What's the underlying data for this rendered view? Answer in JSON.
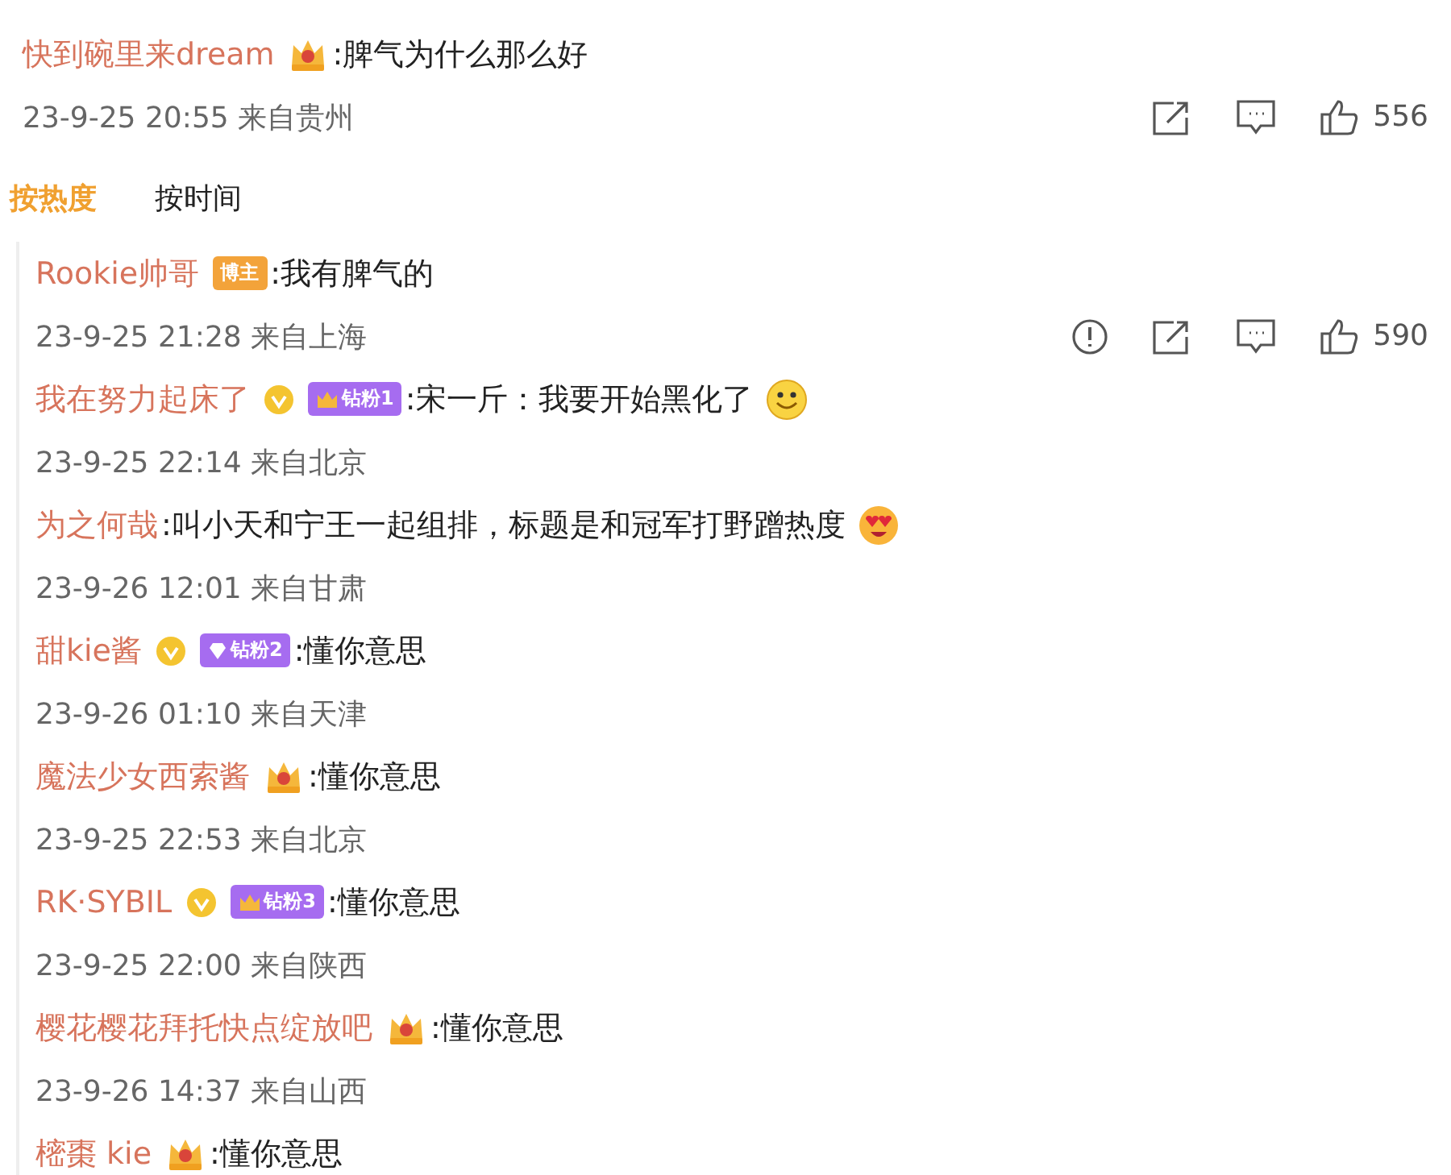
{
  "comment": {
    "name": "快到碗里来dream",
    "badges": [
      {
        "kind": "crown"
      }
    ],
    "text": ":脾气为什么那么好",
    "meta": "23-9-25 20:55 来自贵州",
    "actions": [
      {
        "kind": "share"
      },
      {
        "kind": "comment"
      },
      {
        "kind": "like"
      }
    ],
    "likes": "556"
  },
  "sort_tabs": [
    {
      "label": "按热度",
      "selected": true
    },
    {
      "label": "按时间",
      "selected": false
    }
  ],
  "replies": [
    {
      "name": "Rookie帅哥",
      "badges": [
        {
          "kind": "tag",
          "label": "博主"
        }
      ],
      "text": ":我有脾气的",
      "meta": "23-9-25 21:28 来自上海",
      "actions": [
        {
          "kind": "report"
        },
        {
          "kind": "share"
        },
        {
          "kind": "comment"
        },
        {
          "kind": "like"
        }
      ],
      "likes": "590"
    },
    {
      "name": "我在努力起床了",
      "badges": [
        {
          "kind": "verified"
        },
        {
          "kind": "fan-crown",
          "label": "钻粉1"
        }
      ],
      "text": ":宋一斤：我要开始黑化了",
      "emoji": {
        "kind": "smile"
      },
      "meta": "23-9-25 22:14 来自北京"
    },
    {
      "name": "为之何哉",
      "text": ":叫小天和宁王一起组排，标题是和冠军打野蹭热度",
      "emoji": {
        "kind": "heart-eyes"
      },
      "meta": "23-9-26 12:01 来自甘肃"
    },
    {
      "name": "甜kie酱",
      "badges": [
        {
          "kind": "verified"
        },
        {
          "kind": "fan-diamond",
          "label": "钻粉2"
        }
      ],
      "text": ":懂你意思",
      "meta": "23-9-26 01:10 来自天津"
    },
    {
      "name": "魔法少女西索酱",
      "badges": [
        {
          "kind": "crown"
        }
      ],
      "text": ":懂你意思",
      "meta": "23-9-25 22:53 来自北京"
    },
    {
      "name": "RK·SYBIL",
      "badges": [
        {
          "kind": "verified"
        },
        {
          "kind": "fan-crown",
          "label": "钻粉3"
        }
      ],
      "text": ":懂你意思",
      "meta": "23-9-25 22:00 来自陕西"
    },
    {
      "name": "樱花樱花拜托快点绽放吧",
      "badges": [
        {
          "kind": "crown"
        }
      ],
      "text": ":懂你意思",
      "meta": "23-9-26 14:37 来自山西"
    },
    {
      "name": "樒棗 kie",
      "badges": [
        {
          "kind": "crown"
        }
      ],
      "text": ":懂你意思"
    }
  ]
}
